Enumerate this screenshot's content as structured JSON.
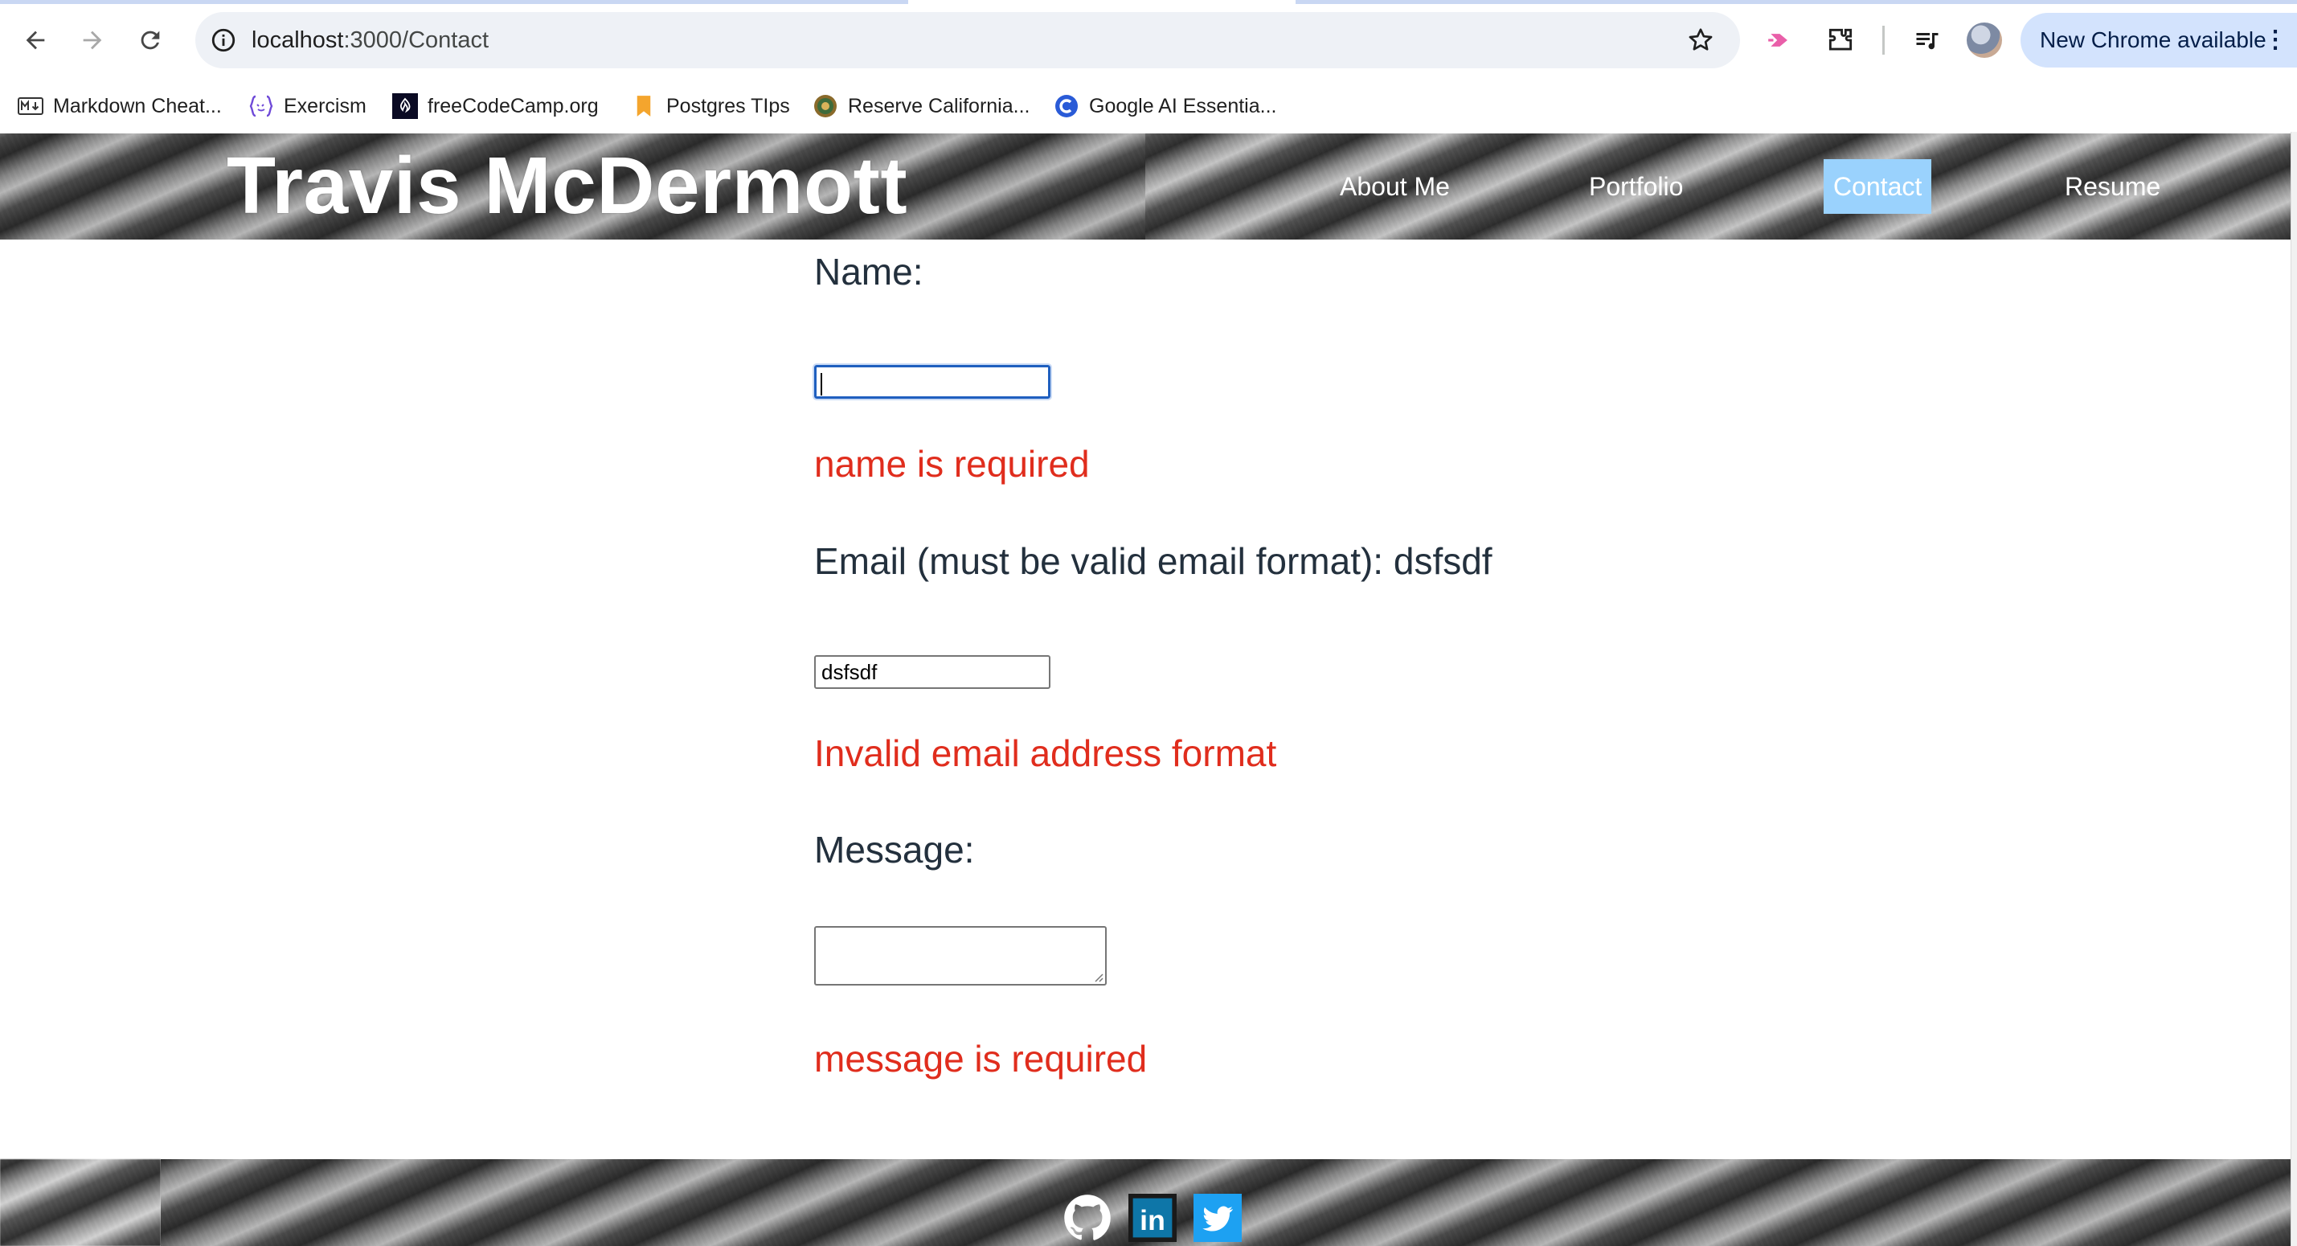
{
  "browser": {
    "url_host": "localhost",
    "url_path": ":3000/Contact",
    "update_label": "New Chrome available",
    "menu_glyph": "⋮",
    "bookmarks": [
      {
        "label": "Markdown Cheat...",
        "icon": "markdown-icon"
      },
      {
        "label": "Exercism",
        "icon": "exercism-icon"
      },
      {
        "label": "freeCodeCamp.org",
        "icon": "freecodecamp-icon"
      },
      {
        "label": "Postgres TIps",
        "icon": "bookmark-icon"
      },
      {
        "label": "Reserve California...",
        "icon": "california-seal-icon"
      },
      {
        "label": "Google AI Essentia...",
        "icon": "coursera-icon"
      }
    ]
  },
  "header": {
    "title": "Travis McDermott",
    "nav": [
      {
        "label": "About Me",
        "active": false
      },
      {
        "label": "Portfolio",
        "active": false
      },
      {
        "label": "Contact",
        "active": true
      },
      {
        "label": "Resume",
        "active": false
      }
    ],
    "active_color": "#8fc2ea"
  },
  "form": {
    "name_label": "Name:",
    "name_value": "",
    "name_error": "name is required",
    "email_label": "Email (must be valid email format): dsfsdf",
    "email_value": "dsfsdf",
    "email_error": "Invalid email address format",
    "message_label": "Message:",
    "message_value": "",
    "message_error": "message is required",
    "error_color": "#e02d1d"
  },
  "footer": {
    "links": [
      {
        "name": "github",
        "icon": "github-icon"
      },
      {
        "name": "linkedin",
        "icon": "linkedin-icon",
        "text": "in"
      },
      {
        "name": "twitter",
        "icon": "twitter-icon"
      }
    ]
  }
}
